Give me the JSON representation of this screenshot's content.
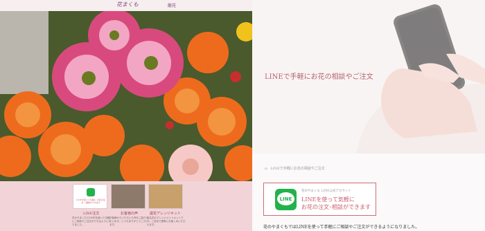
{
  "left_site": {
    "logo": "花まくも",
    "nav": "龍花",
    "cards": [
      {
        "title": "LINE注文",
        "text": "花のやまくもでLINEを使って手軽にご相談やご注文ができるようになりました。"
      },
      {
        "title": "お客様の声",
        "text": "お客様からいただいた声をご紹介しています。いつもありがとうございます。"
      },
      {
        "title": "誕花アレンジキット",
        "text": "誕生花のアレンジメントキットです。ご自宅で簡単にお楽しみいただけます。"
      }
    ],
    "card1_caption": "LINEを使って気軽に お花の注文・相談ができます"
  },
  "right_site": {
    "headline": "LINEで手軽にお花の相談やご注文",
    "breadcrumb": "LINEで手軽にお花の相談やご注文",
    "line_banner": {
      "small": "花のやまくも LINE公式アカウント",
      "line1": "LINEを使って気軽に",
      "line2": "お花の注文･相談ができます",
      "logo_text": "LINE"
    },
    "body": "花のやまくもではLINEを使って手軽にご相談やご注文ができるようになりました。"
  },
  "colors": {
    "accent": "#c95d6b",
    "line_green": "#22b24c",
    "pink_strip": "#f2d4d8"
  }
}
